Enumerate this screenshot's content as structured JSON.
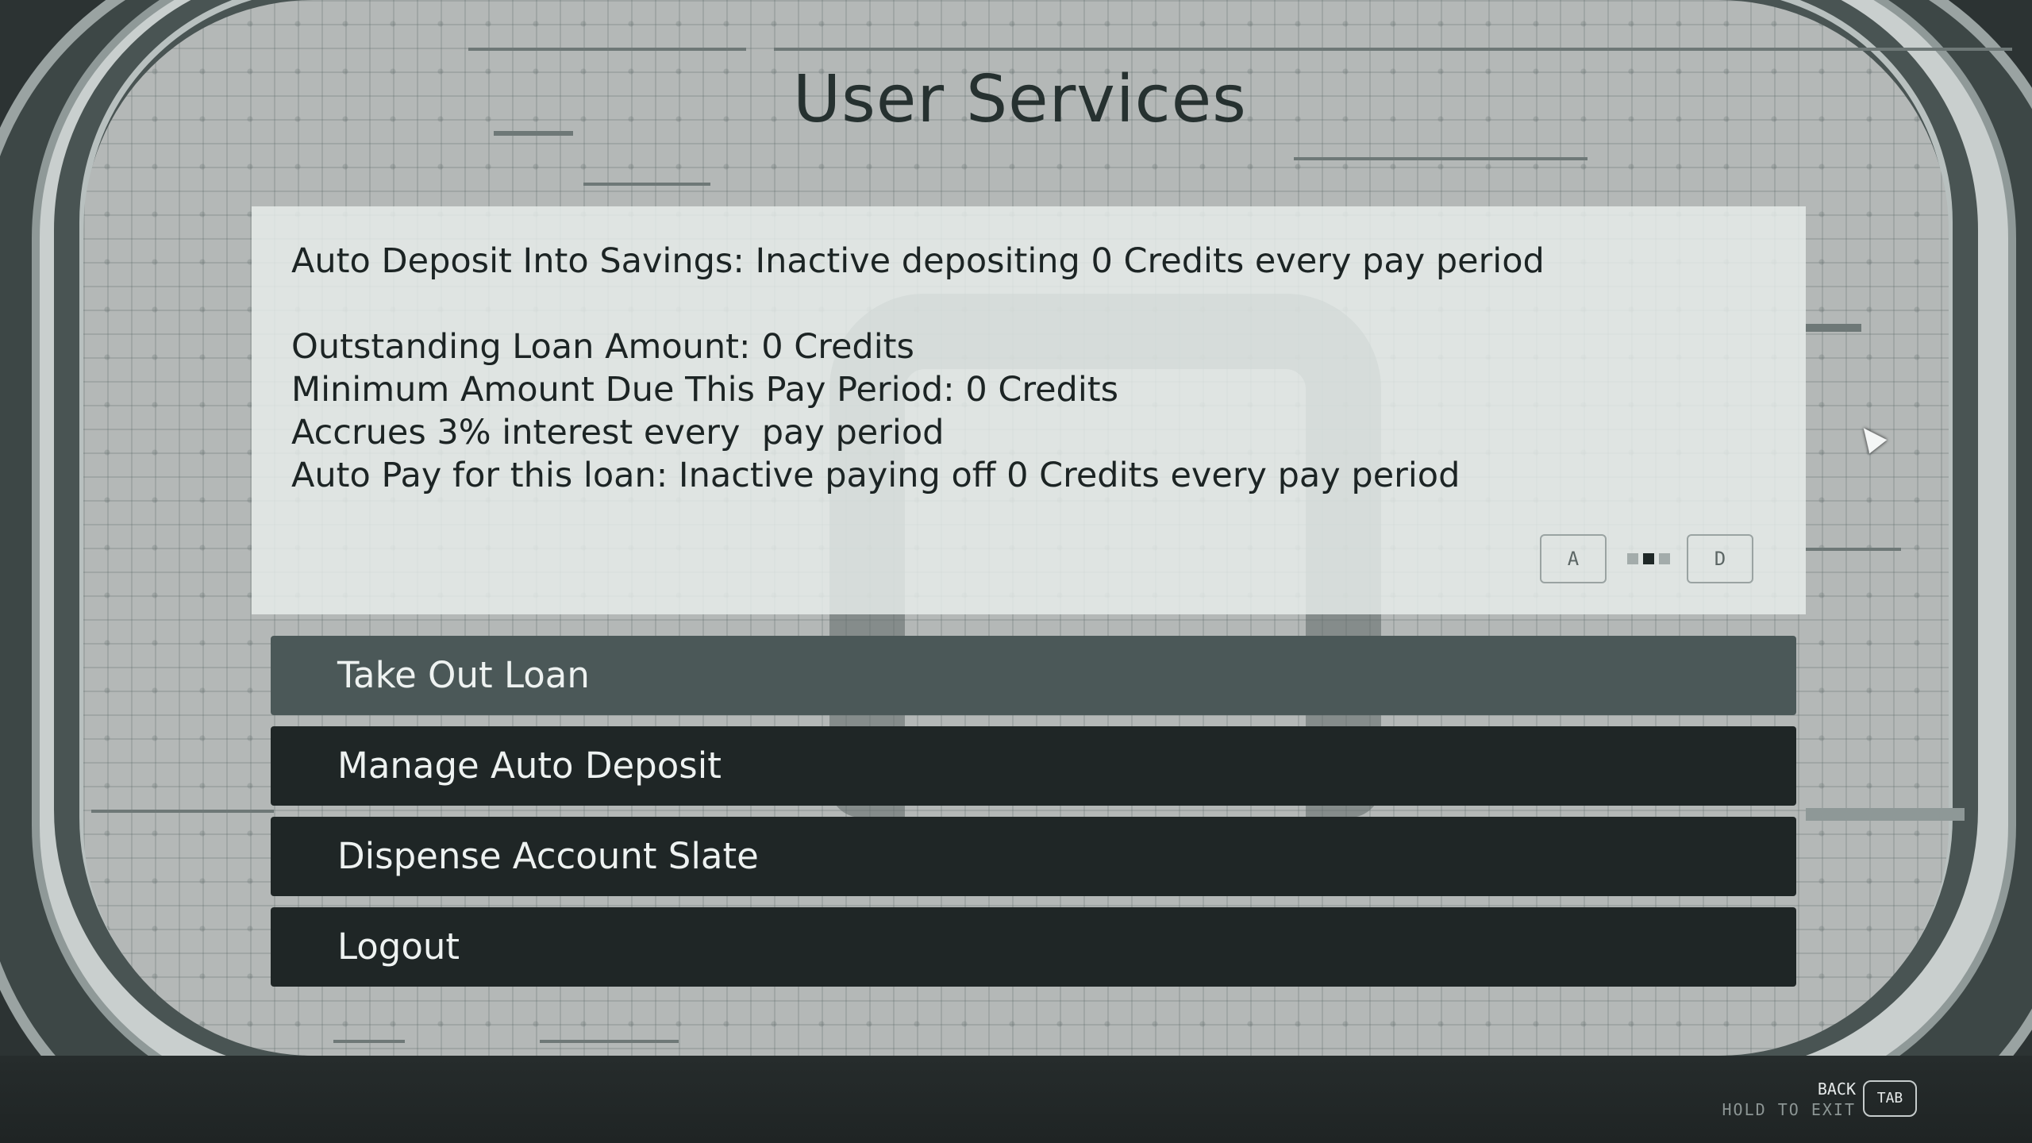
{
  "page": {
    "title": "User Services"
  },
  "info_panel": {
    "lines": [
      "Auto Deposit Into Savings: Inactive depositing 0 Credits every pay period",
      "Outstanding Loan Amount: 0 Credits",
      "Minimum Amount Due This Pay Period: 0 Credits",
      "Accrues 3% interest every  pay period",
      "Auto Pay for this loan: Inactive paying off 0 Credits every pay period"
    ],
    "pager": {
      "prev_key": "A",
      "next_key": "D",
      "pages": 3,
      "current_page": 2
    }
  },
  "menu": {
    "items": [
      {
        "label": "Take Out Loan",
        "selected": true
      },
      {
        "label": "Manage Auto Deposit",
        "selected": false
      },
      {
        "label": "Dispense Account Slate",
        "selected": false
      },
      {
        "label": "Logout",
        "selected": false
      }
    ]
  },
  "footer": {
    "back_label": "BACK",
    "exit_label": "HOLD TO EXIT",
    "key_label": "TAB"
  },
  "colors": {
    "selected_item": "#4b5858",
    "menu_item": "#1f2626",
    "title_text": "#263130"
  }
}
